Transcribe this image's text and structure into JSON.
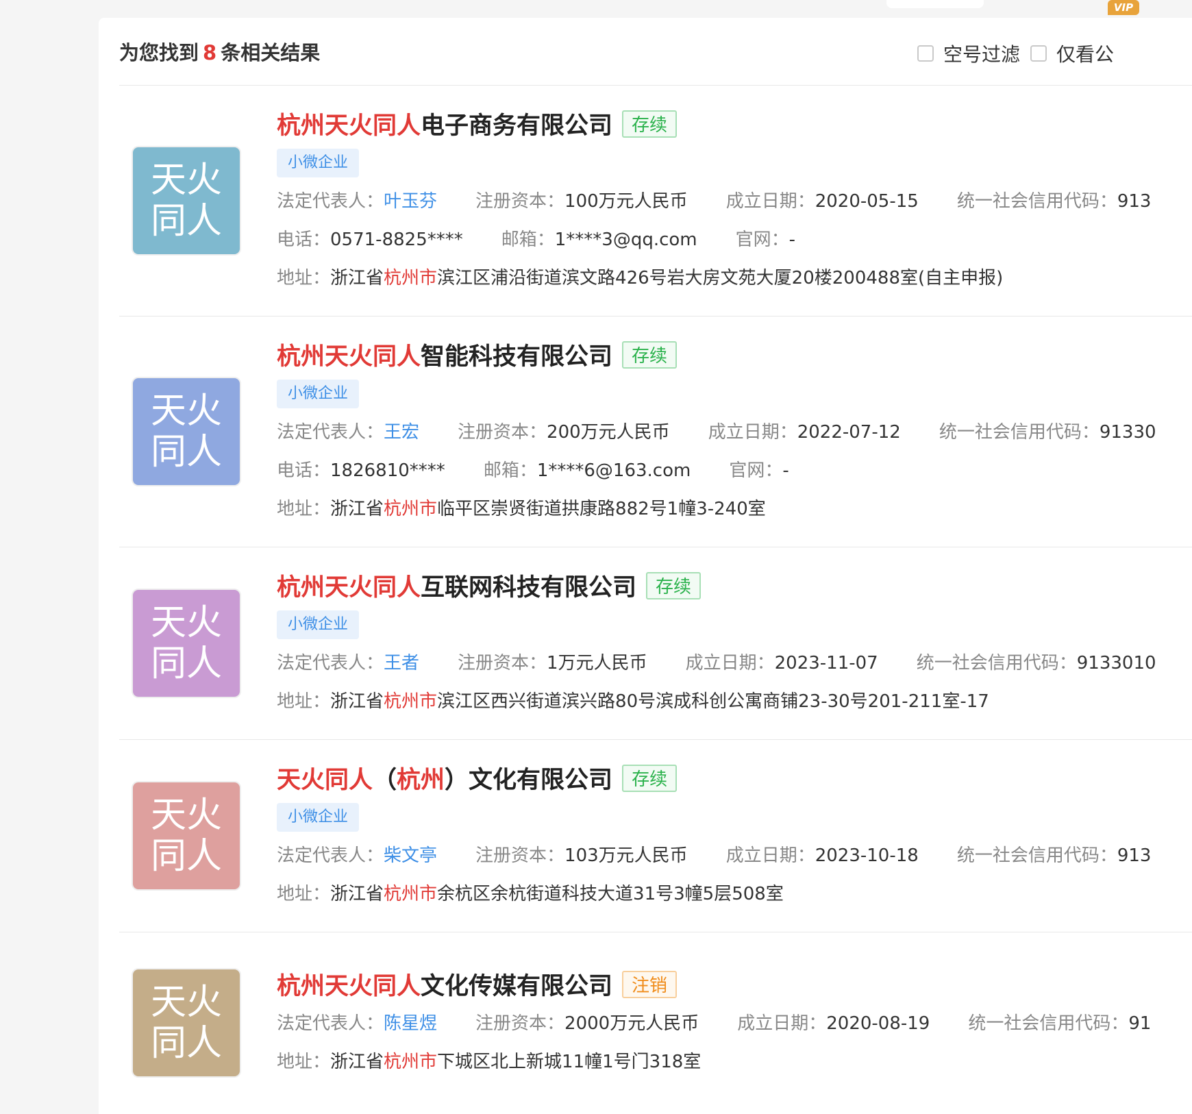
{
  "header": {
    "summary_prefix": "为您找到",
    "summary_count": "8",
    "summary_suffix": "条相关结果",
    "filter_empty_phone": "空号过滤",
    "vip_badge": "VIP",
    "filter_only_view": "仅看公"
  },
  "labels": {
    "legal_rep": "法定代表人：",
    "capital": "注册资本：",
    "founded": "成立日期：",
    "credit_code": "统一社会信用代码：",
    "phone": "电话：",
    "email": "邮箱：",
    "website": "官网：",
    "address": "地址："
  },
  "colors": {
    "highlight": "#e13a36",
    "link": "#3e8fe6",
    "status_active": "#2bb24c",
    "status_cancel": "#f08c1a",
    "logo_1": "#7fb9cf",
    "logo_2": "#8fa8e0",
    "logo_3": "#c99bd3",
    "logo_4": "#dea09e",
    "logo_5": "#c4ad89"
  },
  "companies": [
    {
      "logo_line1": "天火",
      "logo_line2": "同人",
      "name_hl": "杭州天火同人",
      "name_rest": "电子商务有限公司",
      "status": "存续",
      "type_tag": "小微企业",
      "legal_rep": "叶玉芬",
      "capital": "100万元人民币",
      "founded": "2020-05-15",
      "credit_code": "913",
      "phone": "0571-8825****",
      "email": "1****3@qq.com",
      "website": "-",
      "addr_pre": "浙江省",
      "addr_city": "杭州市",
      "addr_rest": "滨江区浦沿街道滨文路426号岩大房文苑大厦20楼200488室(自主申报)"
    },
    {
      "logo_line1": "天火",
      "logo_line2": "同人",
      "name_hl": "杭州天火同人",
      "name_rest": "智能科技有限公司",
      "status": "存续",
      "type_tag": "小微企业",
      "legal_rep": "王宏",
      "capital": "200万元人民币",
      "founded": "2022-07-12",
      "credit_code": "91330",
      "phone": "1826810****",
      "email": "1****6@163.com",
      "website": "-",
      "addr_pre": "浙江省",
      "addr_city": "杭州市",
      "addr_rest": "临平区崇贤街道拱康路882号1幢3-240室"
    },
    {
      "logo_line1": "天火",
      "logo_line2": "同人",
      "name_hl": "杭州天火同人",
      "name_rest": "互联网科技有限公司",
      "status": "存续",
      "type_tag": "小微企业",
      "legal_rep": "王者",
      "capital": "1万元人民币",
      "founded": "2023-11-07",
      "credit_code": "9133010",
      "addr_pre": "浙江省",
      "addr_city": "杭州市",
      "addr_rest": "滨江区西兴街道滨兴路80号滨成科创公寓商铺23-30号201-211室-17"
    },
    {
      "logo_line1": "天火",
      "logo_line2": "同人",
      "name_hl1": "天火同人",
      "name_mid1": "（",
      "name_hl2": "杭州",
      "name_mid2": "）文化有限公司",
      "status": "存续",
      "type_tag": "小微企业",
      "legal_rep": "柴文亭",
      "capital": "103万元人民币",
      "founded": "2023-10-18",
      "credit_code": "913",
      "addr_pre": "浙江省",
      "addr_city": "杭州市",
      "addr_rest": "余杭区余杭街道科技大道31号3幢5层508室"
    },
    {
      "logo_line1": "天火",
      "logo_line2": "同人",
      "name_hl": "杭州天火同人",
      "name_rest": "文化传媒有限公司",
      "status": "注销",
      "legal_rep": "陈星煜",
      "capital": "2000万元人民币",
      "founded": "2020-08-19",
      "credit_code": "91",
      "addr_pre": "浙江省",
      "addr_city": "杭州市",
      "addr_rest": "下城区北上新城11幢1号门318室"
    }
  ]
}
